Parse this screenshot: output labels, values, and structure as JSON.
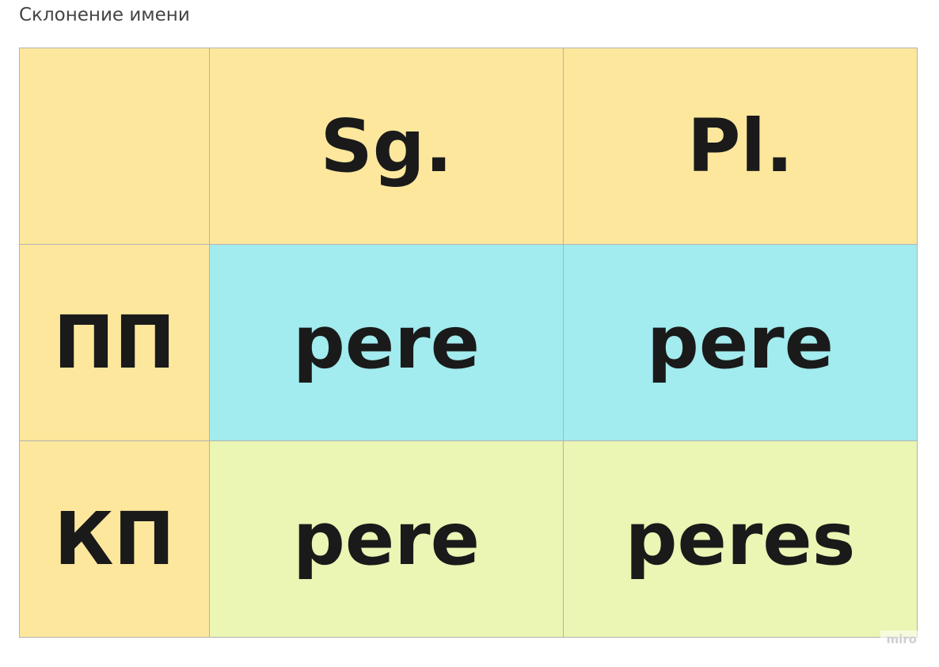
{
  "frame": {
    "title": "Склонение имени"
  },
  "table": {
    "header": {
      "corner": "",
      "columns": [
        "Sg.",
        "Pl."
      ]
    },
    "rows": [
      {
        "label": "ПП",
        "values": [
          "pere",
          "pere"
        ]
      },
      {
        "label": "КП",
        "values": [
          "pere",
          "peres"
        ]
      }
    ]
  },
  "colors": {
    "header_bg": "#fce79d",
    "pp_row_bg": "#a2ebee",
    "kp_row_bg": "#ebf5b4",
    "border": "#b3b3b3",
    "text": "#1a1a1a"
  },
  "watermark": {
    "text": "miro"
  }
}
